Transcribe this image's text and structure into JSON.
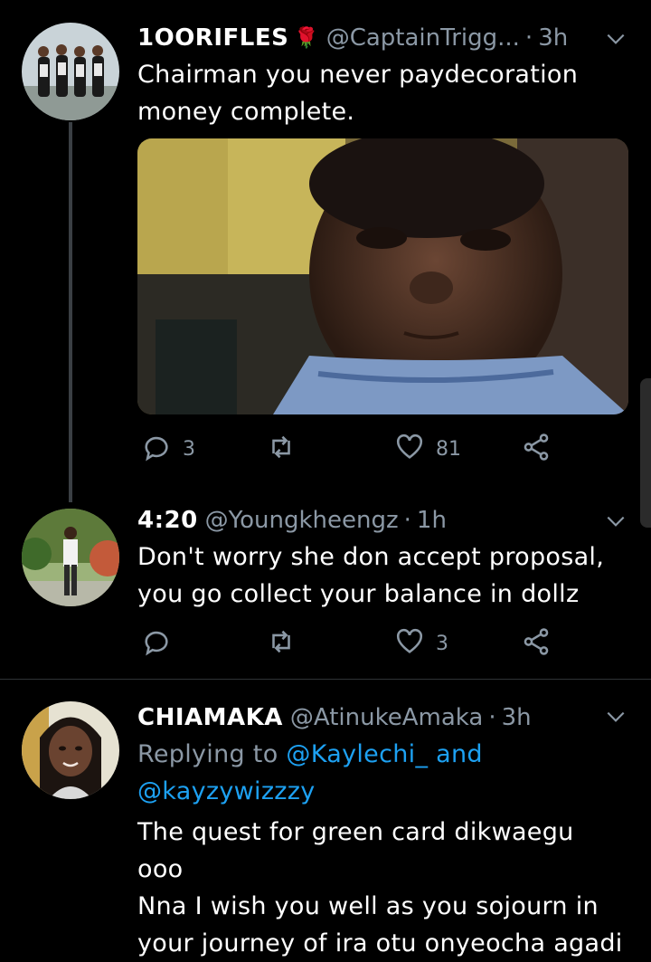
{
  "tweets": [
    {
      "name": "1OORIFLES",
      "name_emoji": "🌹",
      "handle": "@CaptainTrigg...",
      "time": "3h",
      "text_line1": "Chairman you never paydecoration",
      "text_line2": "money complete.",
      "replies": "3",
      "retweets": "",
      "likes": "81"
    },
    {
      "name": "4:20",
      "handle": "@Youngkheengz",
      "time": "1h",
      "text_line1": "Don't worry she don accept proposal,",
      "text_line2": "you go collect your balance in dollz",
      "replies": "",
      "retweets": "",
      "likes": "3"
    },
    {
      "name": "CHIAMAKA",
      "handle": "@AtinukeAmaka",
      "time": "3h",
      "replying_prefix": "Replying to",
      "replying_user1": "@Kaylechi_",
      "replying_and": "and",
      "replying_user2": "@kayzywizzzy",
      "text_line1": "The quest for green card dikwaegu ooo",
      "text_line2": "Nna I wish you well as you sojourn in",
      "text_line3": "your journey of ira otu onyeocha agadi"
    }
  ],
  "icons": {
    "reply": "comment-bubble-icon",
    "retweet": "retweet-icon",
    "like": "heart-icon",
    "share": "share-icon",
    "more": "chevron-down-icon"
  },
  "colors": {
    "background": "#000000",
    "muted": "#8b98a5",
    "link": "#1da1f2",
    "divider": "#2f3336"
  }
}
